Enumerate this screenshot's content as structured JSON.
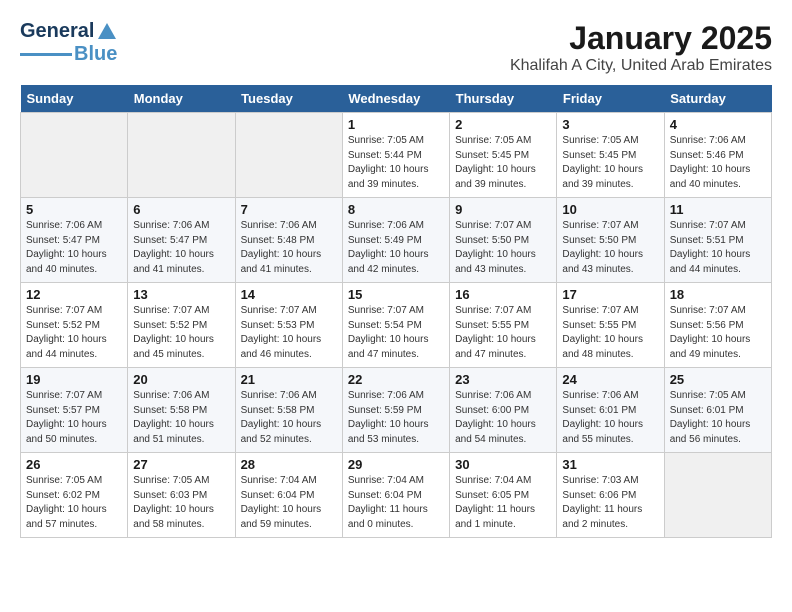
{
  "header": {
    "logo_line1": "General",
    "logo_line2": "Blue",
    "title": "January 2025",
    "subtitle": "Khalifah A City, United Arab Emirates"
  },
  "weekdays": [
    "Sunday",
    "Monday",
    "Tuesday",
    "Wednesday",
    "Thursday",
    "Friday",
    "Saturday"
  ],
  "weeks": [
    [
      {
        "day": "",
        "info": ""
      },
      {
        "day": "",
        "info": ""
      },
      {
        "day": "",
        "info": ""
      },
      {
        "day": "1",
        "info": "Sunrise: 7:05 AM\nSunset: 5:44 PM\nDaylight: 10 hours\nand 39 minutes."
      },
      {
        "day": "2",
        "info": "Sunrise: 7:05 AM\nSunset: 5:45 PM\nDaylight: 10 hours\nand 39 minutes."
      },
      {
        "day": "3",
        "info": "Sunrise: 7:05 AM\nSunset: 5:45 PM\nDaylight: 10 hours\nand 39 minutes."
      },
      {
        "day": "4",
        "info": "Sunrise: 7:06 AM\nSunset: 5:46 PM\nDaylight: 10 hours\nand 40 minutes."
      }
    ],
    [
      {
        "day": "5",
        "info": "Sunrise: 7:06 AM\nSunset: 5:47 PM\nDaylight: 10 hours\nand 40 minutes."
      },
      {
        "day": "6",
        "info": "Sunrise: 7:06 AM\nSunset: 5:47 PM\nDaylight: 10 hours\nand 41 minutes."
      },
      {
        "day": "7",
        "info": "Sunrise: 7:06 AM\nSunset: 5:48 PM\nDaylight: 10 hours\nand 41 minutes."
      },
      {
        "day": "8",
        "info": "Sunrise: 7:06 AM\nSunset: 5:49 PM\nDaylight: 10 hours\nand 42 minutes."
      },
      {
        "day": "9",
        "info": "Sunrise: 7:07 AM\nSunset: 5:50 PM\nDaylight: 10 hours\nand 43 minutes."
      },
      {
        "day": "10",
        "info": "Sunrise: 7:07 AM\nSunset: 5:50 PM\nDaylight: 10 hours\nand 43 minutes."
      },
      {
        "day": "11",
        "info": "Sunrise: 7:07 AM\nSunset: 5:51 PM\nDaylight: 10 hours\nand 44 minutes."
      }
    ],
    [
      {
        "day": "12",
        "info": "Sunrise: 7:07 AM\nSunset: 5:52 PM\nDaylight: 10 hours\nand 44 minutes."
      },
      {
        "day": "13",
        "info": "Sunrise: 7:07 AM\nSunset: 5:52 PM\nDaylight: 10 hours\nand 45 minutes."
      },
      {
        "day": "14",
        "info": "Sunrise: 7:07 AM\nSunset: 5:53 PM\nDaylight: 10 hours\nand 46 minutes."
      },
      {
        "day": "15",
        "info": "Sunrise: 7:07 AM\nSunset: 5:54 PM\nDaylight: 10 hours\nand 47 minutes."
      },
      {
        "day": "16",
        "info": "Sunrise: 7:07 AM\nSunset: 5:55 PM\nDaylight: 10 hours\nand 47 minutes."
      },
      {
        "day": "17",
        "info": "Sunrise: 7:07 AM\nSunset: 5:55 PM\nDaylight: 10 hours\nand 48 minutes."
      },
      {
        "day": "18",
        "info": "Sunrise: 7:07 AM\nSunset: 5:56 PM\nDaylight: 10 hours\nand 49 minutes."
      }
    ],
    [
      {
        "day": "19",
        "info": "Sunrise: 7:07 AM\nSunset: 5:57 PM\nDaylight: 10 hours\nand 50 minutes."
      },
      {
        "day": "20",
        "info": "Sunrise: 7:06 AM\nSunset: 5:58 PM\nDaylight: 10 hours\nand 51 minutes."
      },
      {
        "day": "21",
        "info": "Sunrise: 7:06 AM\nSunset: 5:58 PM\nDaylight: 10 hours\nand 52 minutes."
      },
      {
        "day": "22",
        "info": "Sunrise: 7:06 AM\nSunset: 5:59 PM\nDaylight: 10 hours\nand 53 minutes."
      },
      {
        "day": "23",
        "info": "Sunrise: 7:06 AM\nSunset: 6:00 PM\nDaylight: 10 hours\nand 54 minutes."
      },
      {
        "day": "24",
        "info": "Sunrise: 7:06 AM\nSunset: 6:01 PM\nDaylight: 10 hours\nand 55 minutes."
      },
      {
        "day": "25",
        "info": "Sunrise: 7:05 AM\nSunset: 6:01 PM\nDaylight: 10 hours\nand 56 minutes."
      }
    ],
    [
      {
        "day": "26",
        "info": "Sunrise: 7:05 AM\nSunset: 6:02 PM\nDaylight: 10 hours\nand 57 minutes."
      },
      {
        "day": "27",
        "info": "Sunrise: 7:05 AM\nSunset: 6:03 PM\nDaylight: 10 hours\nand 58 minutes."
      },
      {
        "day": "28",
        "info": "Sunrise: 7:04 AM\nSunset: 6:04 PM\nDaylight: 10 hours\nand 59 minutes."
      },
      {
        "day": "29",
        "info": "Sunrise: 7:04 AM\nSunset: 6:04 PM\nDaylight: 11 hours\nand 0 minutes."
      },
      {
        "day": "30",
        "info": "Sunrise: 7:04 AM\nSunset: 6:05 PM\nDaylight: 11 hours\nand 1 minute."
      },
      {
        "day": "31",
        "info": "Sunrise: 7:03 AM\nSunset: 6:06 PM\nDaylight: 11 hours\nand 2 minutes."
      },
      {
        "day": "",
        "info": ""
      }
    ]
  ]
}
